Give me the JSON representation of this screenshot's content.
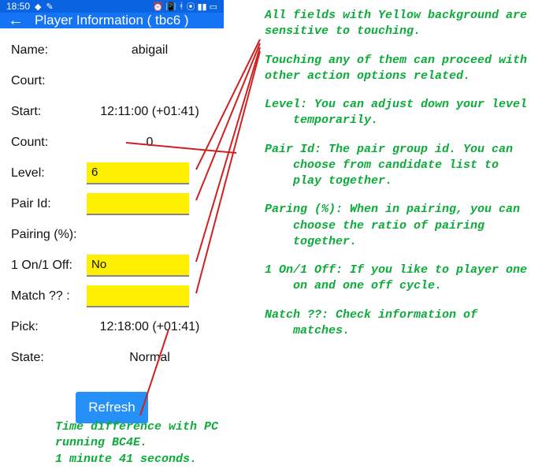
{
  "status": {
    "time": "18:50",
    "icons_left": [
      "card",
      "edit"
    ],
    "icons_right": [
      "alarm",
      "vibrate",
      "bt",
      "wifi",
      "signal",
      "battery"
    ]
  },
  "appbar": {
    "title": "Player Information ( tbc6 )"
  },
  "form": {
    "name_label": "Name:",
    "name_value": "abigail",
    "court_label": "Court:",
    "court_value": "",
    "start_label": "Start:",
    "start_value": "12:11:00 (+01:41)",
    "count_label": "Count:",
    "count_value": "0",
    "level_label": "Level:",
    "level_value": "6",
    "pairid_label": "Pair Id:",
    "pairid_value": "",
    "pairing_label": "Pairing (%):",
    "pairing_value": "",
    "onoff_label": "1 On/1 Off:",
    "onoff_value": "No",
    "match_label": "Match ?? :",
    "match_value": "",
    "pick_label": "Pick:",
    "pick_value": "12:18:00 (+01:41)",
    "state_label": "State:",
    "state_value": "Normal"
  },
  "buttons": {
    "refresh": "Refresh"
  },
  "annotations": {
    "intro": "All fields with Yellow background are sensitive to touching.",
    "touch": "Touching any of them can proceed with other action options related.",
    "level": "Level: You can adjust down your level temporarily.",
    "pairid": "Pair Id: The pair group id. You can choose from candidate list to play together.",
    "pairing": "Paring (%): When in pairing, you can choose the ratio of pairing together.",
    "onoff": "1 On/1 Off: If you like to player one on and one off cycle.",
    "match": "Natch ??: Check information of matches.",
    "bottom": "Time difference with PC running BC4E.\n1 minute 41 seconds."
  }
}
